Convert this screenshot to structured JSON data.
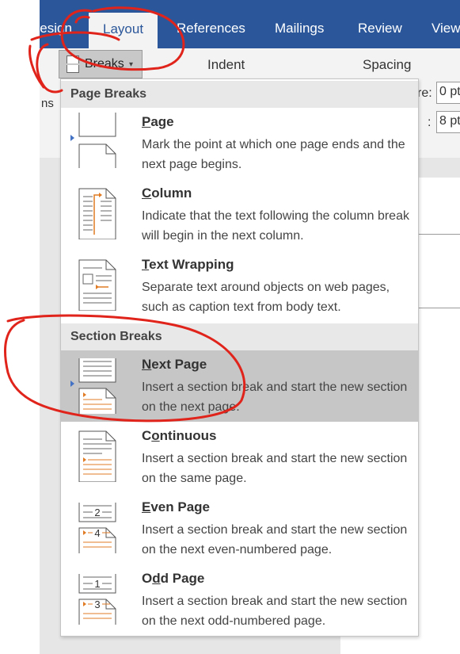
{
  "ribbon": {
    "tabs": [
      {
        "label": "Design"
      },
      {
        "label": "Layout"
      },
      {
        "label": "References"
      },
      {
        "label": "Mailings"
      },
      {
        "label": "Review"
      },
      {
        "label": "View"
      }
    ],
    "active_tab": "Layout",
    "breaks_label": "Breaks",
    "indent_label": "Indent",
    "spacing_label": "Spacing",
    "left_cut_label": "ns",
    "before_label": "re:",
    "before_value": "0 pt",
    "after_label": ":",
    "after_value": "8 pt"
  },
  "menu": {
    "page_breaks_header": "Page Breaks",
    "section_breaks_header": "Section Breaks",
    "items": [
      {
        "title": "Page",
        "underline": "P",
        "rest": "age",
        "desc": "Mark the point at which one page ends and the next page begins."
      },
      {
        "title": "Column",
        "underline": "C",
        "rest": "olumn",
        "desc": "Indicate that the text following the column break will begin in the next column."
      },
      {
        "title": "Text Wrapping",
        "underline": "T",
        "rest": "ext Wrapping",
        "desc": "Separate text around objects on web pages, such as caption text from body text."
      },
      {
        "title": "Next Page",
        "underline": "N",
        "rest": "ext Page",
        "desc": "Insert a section break and start the new section on the next page."
      },
      {
        "title": "Continuous",
        "underline": "o",
        "pre": "C",
        "rest": "ntinuous",
        "desc": "Insert a section break and start the new section on the same page."
      },
      {
        "title": "Even Page",
        "underline": "E",
        "rest": "ven Page",
        "desc": "Insert a section break and start the new section on the next even-numbered page."
      },
      {
        "title": "Odd Page",
        "underline": "d",
        "pre": "O",
        "rest": "d Page",
        "desc": "Insert a section break and start the new section on the next odd-numbered page."
      }
    ],
    "highlighted_item": "Next Page",
    "even_icon_numbers": [
      "2",
      "4"
    ],
    "odd_icon_numbers": [
      "1",
      "3"
    ]
  },
  "colors": {
    "ribbon_blue": "#2b579a",
    "hover_gray": "#c6c6c6",
    "annotation_red": "#e0241c",
    "break_orange": "#e07b24"
  }
}
